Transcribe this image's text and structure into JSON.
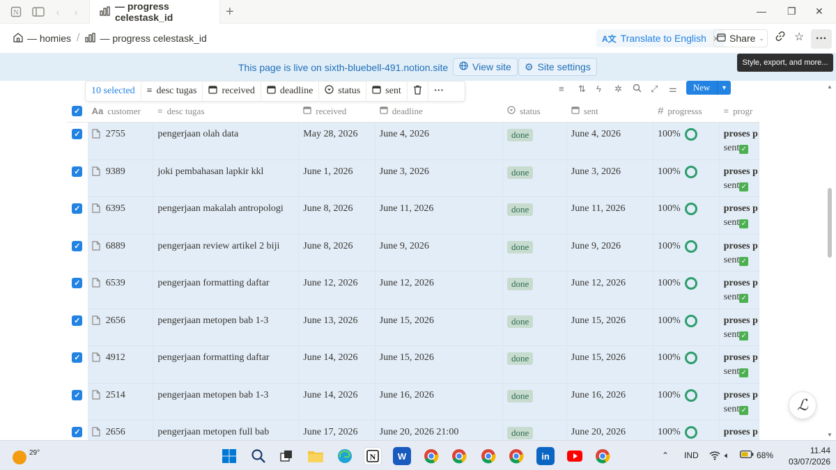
{
  "window": {
    "tab_title": "— progress celestask_id",
    "tab_icon": "chart-icon",
    "plus": "+"
  },
  "breadcrumb": {
    "items": [
      {
        "label": "— homies",
        "icon": "home-icon"
      },
      {
        "label": "— progress celestask_id",
        "icon": "chart-icon"
      }
    ],
    "separator": "/"
  },
  "topbar": {
    "translate_label": "Translate to English",
    "translate_close": "×",
    "share_label": "Share",
    "tooltip": "Style, export, and more..."
  },
  "banner": {
    "text": "This page is live on sixth-bluebell-491.notion.site",
    "view_site": "View site",
    "site_settings": "Site settings"
  },
  "selection_bar": {
    "count": "10 selected",
    "items": [
      "desc tugas",
      "received",
      "deadline",
      "status",
      "sent"
    ]
  },
  "toolbar": {
    "new_label": "New"
  },
  "columns": [
    "customer",
    "desc tugas",
    "received",
    "deadline",
    "status",
    "sent",
    "progresss",
    "progr"
  ],
  "rows": [
    {
      "customer": "2755",
      "desc": "pengerjaan olah data",
      "received": "May 28, 2026",
      "deadline": "June 4, 2026",
      "status": "done",
      "sent": "June 4, 2026",
      "progress": "100%",
      "prog_title": "proses p",
      "prog_sub": "sent"
    },
    {
      "customer": "9389",
      "desc": "joki pembahasan lapkir kkl",
      "received": "June 1, 2026",
      "deadline": "June 3, 2026",
      "status": "done",
      "sent": "June 3, 2026",
      "progress": "100%",
      "prog_title": "proses p",
      "prog_sub": "sent"
    },
    {
      "customer": "6395",
      "desc": "pengerjaan makalah antropologi",
      "received": "June 8, 2026",
      "deadline": "June 11, 2026",
      "status": "done",
      "sent": "June 11, 2026",
      "progress": "100%",
      "prog_title": "proses p",
      "prog_sub": "sent"
    },
    {
      "customer": "6889",
      "desc": "pengerjaan review artikel 2 biji",
      "received": "June 8, 2026",
      "deadline": "June 9, 2026",
      "status": "done",
      "sent": "June 9, 2026",
      "progress": "100%",
      "prog_title": "proses p",
      "prog_sub": "sent"
    },
    {
      "customer": "6539",
      "desc": "pengerjaan formatting daftar",
      "received": "June 12, 2026",
      "deadline": "June 12, 2026",
      "status": "done",
      "sent": "June 12, 2026",
      "progress": "100%",
      "prog_title": "proses p",
      "prog_sub": "sent"
    },
    {
      "customer": "2656",
      "desc": "pengerjaan metopen bab 1-3",
      "received": "June 13, 2026",
      "deadline": "June 15, 2026",
      "status": "done",
      "sent": "June 15, 2026",
      "progress": "100%",
      "prog_title": "proses p",
      "prog_sub": "sent"
    },
    {
      "customer": "4912",
      "desc": "pengerjaan formatting daftar",
      "received": "June 14, 2026",
      "deadline": "June 15, 2026",
      "status": "done",
      "sent": "June 15, 2026",
      "progress": "100%",
      "prog_title": "proses p",
      "prog_sub": "sent"
    },
    {
      "customer": "2514",
      "desc": "pengerjaan metopen bab 1-3",
      "received": "June 14, 2026",
      "deadline": "June 16, 2026",
      "status": "done",
      "sent": "June 16, 2026",
      "progress": "100%",
      "prog_title": "proses p",
      "prog_sub": "sent"
    },
    {
      "customer": "2656",
      "desc": "pengerjaan metopen full bab",
      "received": "June 17, 2026",
      "deadline": "June 20, 2026 21:00",
      "status": "done",
      "sent": "June 20, 2026",
      "progress": "100%",
      "prog_title": "proses p",
      "prog_sub": "sent"
    }
  ],
  "taskbar": {
    "temperature": "29°",
    "language": "IND",
    "battery": "68%",
    "time": "11.44",
    "date": "03/07/2026"
  },
  "colors": {
    "accent": "#2383e2",
    "selected_row": "#e3edf8",
    "banner": "#e1eef8",
    "status_done_bg": "#c7dccf",
    "progress_ring": "#2c9d6c"
  }
}
